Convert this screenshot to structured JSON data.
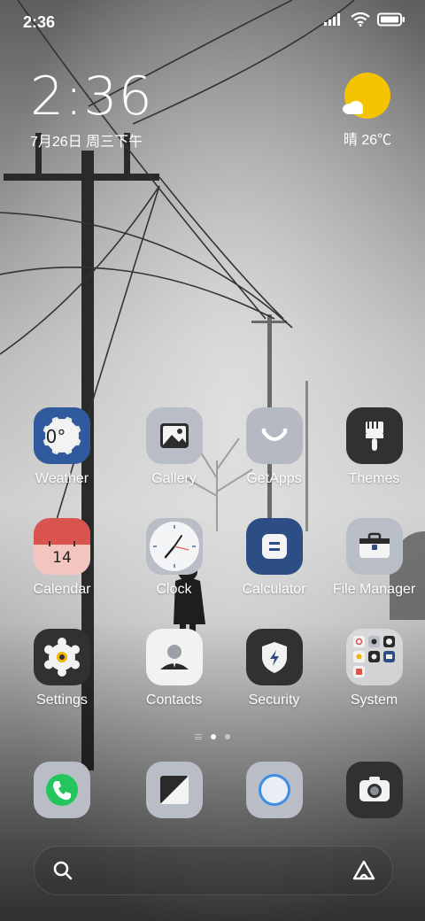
{
  "status_bar": {
    "time": "2:36",
    "icons": [
      "signal-icon",
      "wifi-icon",
      "battery-icon"
    ]
  },
  "clock_widget": {
    "time": "2:36",
    "date": "7月26日 周三下午"
  },
  "weather_widget": {
    "condition_icon": "sun-icon",
    "text": "晴 26℃"
  },
  "apps": [
    {
      "label": "Weather",
      "icon": "weather-icon"
    },
    {
      "label": "Gallery",
      "icon": "gallery-icon"
    },
    {
      "label": "GetApps",
      "icon": "getapps-icon"
    },
    {
      "label": "Themes",
      "icon": "themes-icon"
    },
    {
      "label": "Calendar",
      "icon": "calendar-icon",
      "day": "14"
    },
    {
      "label": "Clock",
      "icon": "clock-icon"
    },
    {
      "label": "Calculator",
      "icon": "calculator-icon"
    },
    {
      "label": "File Manager",
      "icon": "file-manager-icon"
    },
    {
      "label": "Settings",
      "icon": "settings-icon"
    },
    {
      "label": "Contacts",
      "icon": "contacts-icon"
    },
    {
      "label": "Security",
      "icon": "security-icon"
    },
    {
      "label": "System",
      "icon": "system-folder-icon"
    }
  ],
  "weather_app_temp": "0°",
  "page_indicator": {
    "pages": 2,
    "current": 1
  },
  "dock": [
    {
      "name": "phone",
      "icon": "phone-icon"
    },
    {
      "name": "messaging",
      "icon": "messaging-icon"
    },
    {
      "name": "browser",
      "icon": "browser-icon"
    },
    {
      "name": "camera",
      "icon": "camera-icon"
    }
  ],
  "search_bar": {
    "left_icon": "search-icon",
    "right_icon": "assistant-icon"
  },
  "colors": {
    "sun": "#f5c400",
    "calendar_top": "#d9534f",
    "calculator": "#2c4e84",
    "weather_blue": "#2f5a9e"
  }
}
